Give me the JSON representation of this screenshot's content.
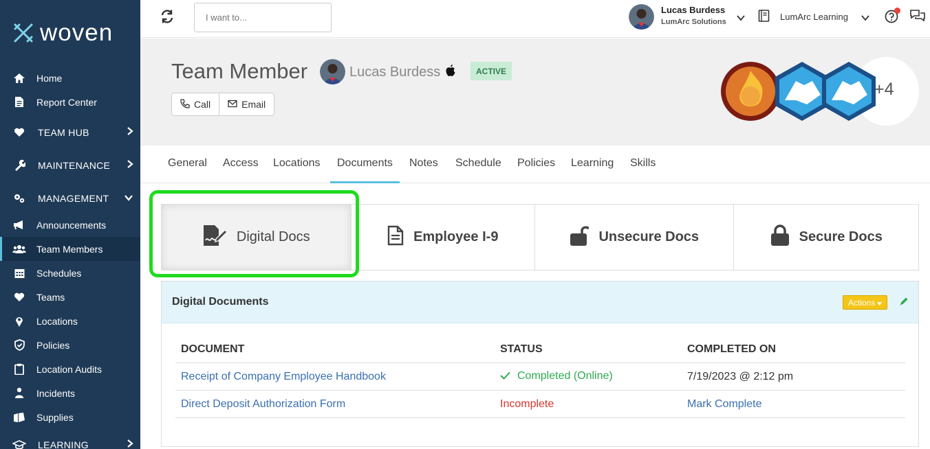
{
  "sidebar": {
    "brand": "woven",
    "items": [
      {
        "label": "Home",
        "icon": "home-icon"
      },
      {
        "label": "Report Center",
        "icon": "report-icon"
      },
      {
        "label": "TEAM HUB",
        "icon": "heart-icon"
      },
      {
        "label": "MAINTENANCE",
        "icon": "wrench-icon"
      },
      {
        "label": "MANAGEMENT",
        "icon": "cogs-icon"
      },
      {
        "label": "Announcements",
        "icon": "megaphone-icon"
      },
      {
        "label": "Team Members",
        "icon": "users-icon"
      },
      {
        "label": "Schedules",
        "icon": "calendar-icon"
      },
      {
        "label": "Teams",
        "icon": "heart-icon"
      },
      {
        "label": "Locations",
        "icon": "map-pin-icon"
      },
      {
        "label": "Policies",
        "icon": "shield-icon"
      },
      {
        "label": "Location Audits",
        "icon": "clipboard-icon"
      },
      {
        "label": "Incidents",
        "icon": "person-icon"
      },
      {
        "label": "Supplies",
        "icon": "supplies-icon"
      },
      {
        "label": "LEARNING",
        "icon": "graduation-cap-icon"
      }
    ]
  },
  "topbar": {
    "search_placeholder": "I want to...",
    "user_name": "Lucas Burdess",
    "user_org": "LumArc Solutions",
    "org_name": "LumArc Learning"
  },
  "header": {
    "title": "Team Member",
    "member_name": "Lucas Burdess",
    "status": "ACTIVE",
    "call_label": "Call",
    "email_label": "Email",
    "badge_more": "+4"
  },
  "tabs": [
    "General",
    "Access",
    "Locations",
    "Documents",
    "Notes",
    "Schedule",
    "Policies",
    "Learning",
    "Skills"
  ],
  "active_tab": "Documents",
  "doc_types": [
    "Digital Docs",
    "Employee I-9",
    "Unsecure Docs",
    "Secure Docs"
  ],
  "panel": {
    "title": "Digital Documents",
    "actions_label": "Actions",
    "columns": [
      "DOCUMENT",
      "STATUS",
      "COMPLETED ON"
    ],
    "rows": [
      {
        "document": "Receipt of Company Employee Handbook",
        "status": "Completed (Online)",
        "completed_on": "7/19/2023 @ 2:12 pm"
      },
      {
        "document": "Direct Deposit Authorization Form",
        "status": "Incomplete",
        "completed_on": "Mark Complete"
      }
    ]
  },
  "colors": {
    "sidebar_bg": "#1f3a56",
    "accent": "#5bc0de",
    "highlight": "#1fdb1f",
    "actions": "#f5c518",
    "complete": "#2eaa4f",
    "incomplete": "#d9342b",
    "link": "#3a6fb0"
  }
}
